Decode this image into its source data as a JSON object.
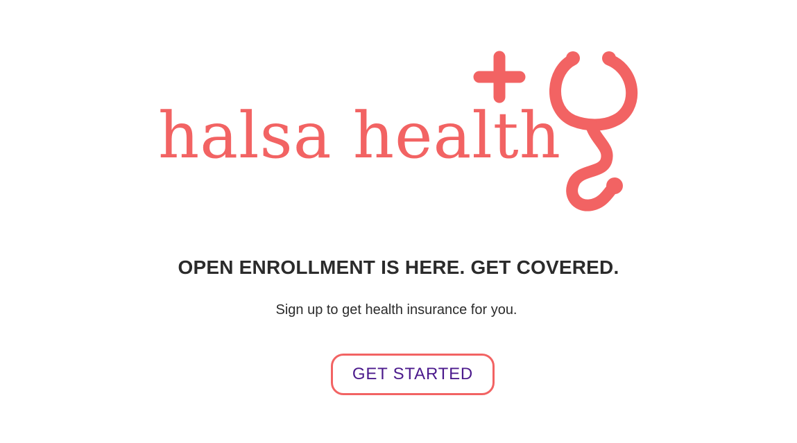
{
  "brand": {
    "name": "halsa health",
    "color": "#f26363",
    "icons": [
      "plus-icon",
      "stethoscope-icon"
    ]
  },
  "content": {
    "headline": "OPEN ENROLLMENT IS HERE. GET COVERED.",
    "subline": "Sign up to get health insurance for you.",
    "cta_label": "GET STARTED",
    "cta_text_color": "#4b1a8c",
    "text_color": "#2b2b2b"
  }
}
